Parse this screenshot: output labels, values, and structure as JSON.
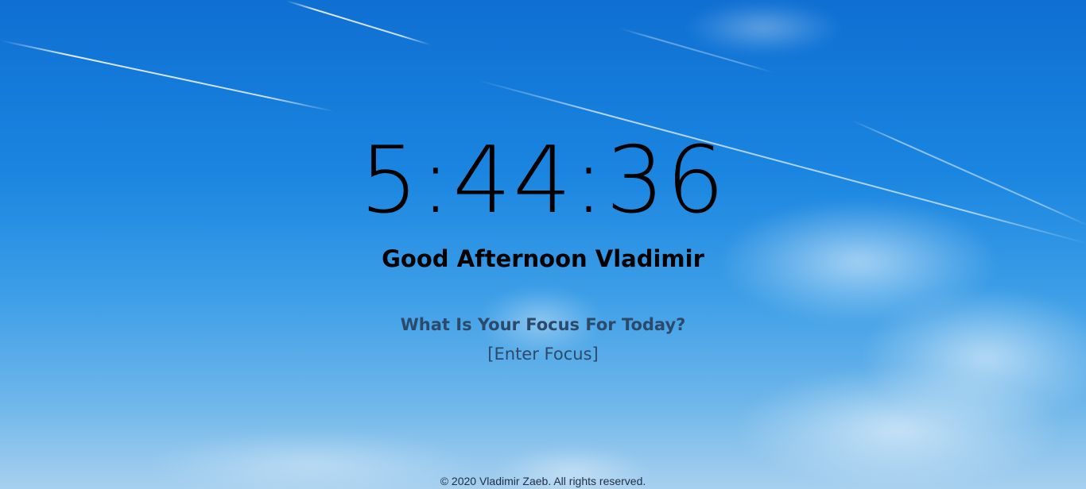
{
  "clock": {
    "time": "5:44:36"
  },
  "greeting": {
    "text": "Good Afternoon Vladimir"
  },
  "focus": {
    "question": "What Is Your Focus For Today?",
    "input_text": "[Enter Focus]"
  },
  "footer": {
    "copyright": "© 2020 Vladimir Zaeb. All rights reserved."
  },
  "colors": {
    "sky_top": "#0f6fd2",
    "sky_bottom": "#a7d0ef",
    "text_primary": "#000000",
    "text_secondary": "#2b4a6b"
  }
}
